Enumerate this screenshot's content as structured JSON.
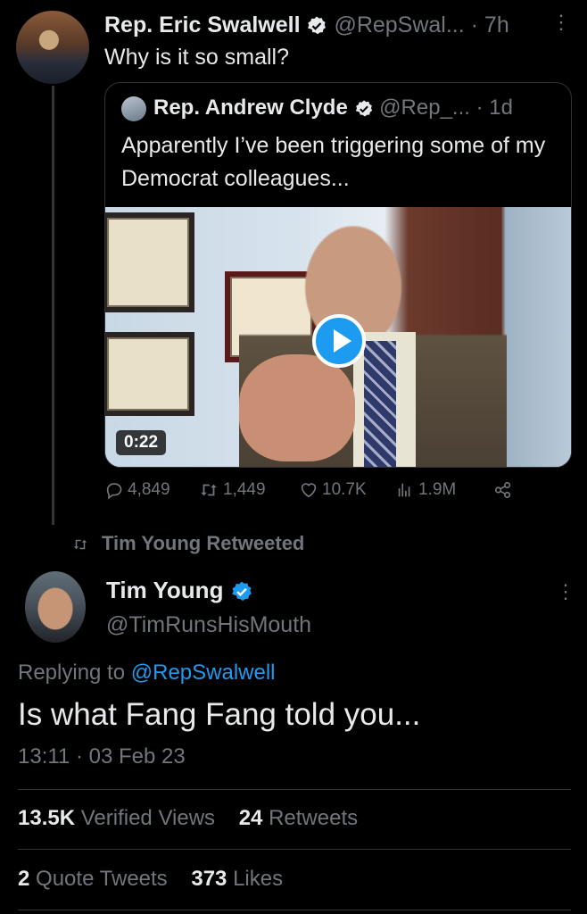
{
  "parent_tweet": {
    "name": "Rep. Eric Swalwell",
    "handle": "@RepSwal...",
    "time": "· 7h",
    "text": "Why is it so small?",
    "quoted": {
      "name": "Rep. Andrew Clyde",
      "handle": "@Rep_...",
      "time": "· 1d",
      "text": "Apparently I’ve been triggering some of my Democrat colleagues...",
      "video_duration": "0:22"
    },
    "actions": {
      "replies": "4,849",
      "retweets": "1,449",
      "likes": "10.7K",
      "views": "1.9M"
    }
  },
  "retweet_context": "Tim Young Retweeted",
  "main_tweet": {
    "name": "Tim Young",
    "handle": "@TimRunsHisMouth",
    "replying_prefix": "Replying to",
    "replying_to": "@RepSwalwell",
    "text": "Is what Fang Fang told you...",
    "timestamp": "13:11 · 03 Feb 23",
    "stats": {
      "views_count": "13.5K",
      "views_label": "Verified Views",
      "retweets_count": "24",
      "retweets_label": "Retweets",
      "quotes_count": "2",
      "quotes_label": "Quote Tweets",
      "likes_count": "373",
      "likes_label": "Likes"
    }
  },
  "colors": {
    "accent": "#1d9bf0",
    "muted": "#71767b",
    "text": "#e7e9ea",
    "background": "#000000"
  }
}
